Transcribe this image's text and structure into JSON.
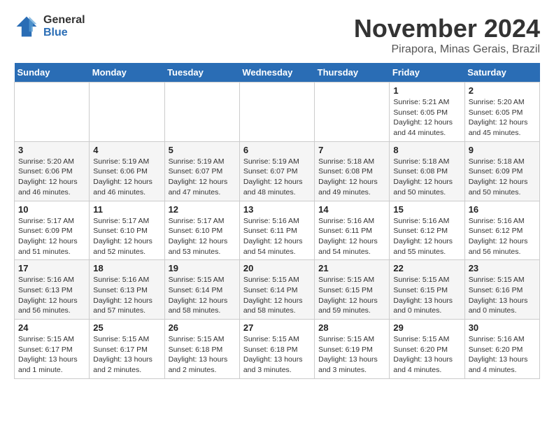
{
  "header": {
    "logo_general": "General",
    "logo_blue": "Blue",
    "month_title": "November 2024",
    "location": "Pirapora, Minas Gerais, Brazil"
  },
  "weekdays": [
    "Sunday",
    "Monday",
    "Tuesday",
    "Wednesday",
    "Thursday",
    "Friday",
    "Saturday"
  ],
  "weeks": [
    [
      {
        "day": "",
        "info": ""
      },
      {
        "day": "",
        "info": ""
      },
      {
        "day": "",
        "info": ""
      },
      {
        "day": "",
        "info": ""
      },
      {
        "day": "",
        "info": ""
      },
      {
        "day": "1",
        "info": "Sunrise: 5:21 AM\nSunset: 6:05 PM\nDaylight: 12 hours\nand 44 minutes."
      },
      {
        "day": "2",
        "info": "Sunrise: 5:20 AM\nSunset: 6:05 PM\nDaylight: 12 hours\nand 45 minutes."
      }
    ],
    [
      {
        "day": "3",
        "info": "Sunrise: 5:20 AM\nSunset: 6:06 PM\nDaylight: 12 hours\nand 46 minutes."
      },
      {
        "day": "4",
        "info": "Sunrise: 5:19 AM\nSunset: 6:06 PM\nDaylight: 12 hours\nand 46 minutes."
      },
      {
        "day": "5",
        "info": "Sunrise: 5:19 AM\nSunset: 6:07 PM\nDaylight: 12 hours\nand 47 minutes."
      },
      {
        "day": "6",
        "info": "Sunrise: 5:19 AM\nSunset: 6:07 PM\nDaylight: 12 hours\nand 48 minutes."
      },
      {
        "day": "7",
        "info": "Sunrise: 5:18 AM\nSunset: 6:08 PM\nDaylight: 12 hours\nand 49 minutes."
      },
      {
        "day": "8",
        "info": "Sunrise: 5:18 AM\nSunset: 6:08 PM\nDaylight: 12 hours\nand 50 minutes."
      },
      {
        "day": "9",
        "info": "Sunrise: 5:18 AM\nSunset: 6:09 PM\nDaylight: 12 hours\nand 50 minutes."
      }
    ],
    [
      {
        "day": "10",
        "info": "Sunrise: 5:17 AM\nSunset: 6:09 PM\nDaylight: 12 hours\nand 51 minutes."
      },
      {
        "day": "11",
        "info": "Sunrise: 5:17 AM\nSunset: 6:10 PM\nDaylight: 12 hours\nand 52 minutes."
      },
      {
        "day": "12",
        "info": "Sunrise: 5:17 AM\nSunset: 6:10 PM\nDaylight: 12 hours\nand 53 minutes."
      },
      {
        "day": "13",
        "info": "Sunrise: 5:16 AM\nSunset: 6:11 PM\nDaylight: 12 hours\nand 54 minutes."
      },
      {
        "day": "14",
        "info": "Sunrise: 5:16 AM\nSunset: 6:11 PM\nDaylight: 12 hours\nand 54 minutes."
      },
      {
        "day": "15",
        "info": "Sunrise: 5:16 AM\nSunset: 6:12 PM\nDaylight: 12 hours\nand 55 minutes."
      },
      {
        "day": "16",
        "info": "Sunrise: 5:16 AM\nSunset: 6:12 PM\nDaylight: 12 hours\nand 56 minutes."
      }
    ],
    [
      {
        "day": "17",
        "info": "Sunrise: 5:16 AM\nSunset: 6:13 PM\nDaylight: 12 hours\nand 56 minutes."
      },
      {
        "day": "18",
        "info": "Sunrise: 5:16 AM\nSunset: 6:13 PM\nDaylight: 12 hours\nand 57 minutes."
      },
      {
        "day": "19",
        "info": "Sunrise: 5:15 AM\nSunset: 6:14 PM\nDaylight: 12 hours\nand 58 minutes."
      },
      {
        "day": "20",
        "info": "Sunrise: 5:15 AM\nSunset: 6:14 PM\nDaylight: 12 hours\nand 58 minutes."
      },
      {
        "day": "21",
        "info": "Sunrise: 5:15 AM\nSunset: 6:15 PM\nDaylight: 12 hours\nand 59 minutes."
      },
      {
        "day": "22",
        "info": "Sunrise: 5:15 AM\nSunset: 6:15 PM\nDaylight: 13 hours\nand 0 minutes."
      },
      {
        "day": "23",
        "info": "Sunrise: 5:15 AM\nSunset: 6:16 PM\nDaylight: 13 hours\nand 0 minutes."
      }
    ],
    [
      {
        "day": "24",
        "info": "Sunrise: 5:15 AM\nSunset: 6:17 PM\nDaylight: 13 hours\nand 1 minute."
      },
      {
        "day": "25",
        "info": "Sunrise: 5:15 AM\nSunset: 6:17 PM\nDaylight: 13 hours\nand 2 minutes."
      },
      {
        "day": "26",
        "info": "Sunrise: 5:15 AM\nSunset: 6:18 PM\nDaylight: 13 hours\nand 2 minutes."
      },
      {
        "day": "27",
        "info": "Sunrise: 5:15 AM\nSunset: 6:18 PM\nDaylight: 13 hours\nand 3 minutes."
      },
      {
        "day": "28",
        "info": "Sunrise: 5:15 AM\nSunset: 6:19 PM\nDaylight: 13 hours\nand 3 minutes."
      },
      {
        "day": "29",
        "info": "Sunrise: 5:15 AM\nSunset: 6:20 PM\nDaylight: 13 hours\nand 4 minutes."
      },
      {
        "day": "30",
        "info": "Sunrise: 5:16 AM\nSunset: 6:20 PM\nDaylight: 13 hours\nand 4 minutes."
      }
    ]
  ]
}
